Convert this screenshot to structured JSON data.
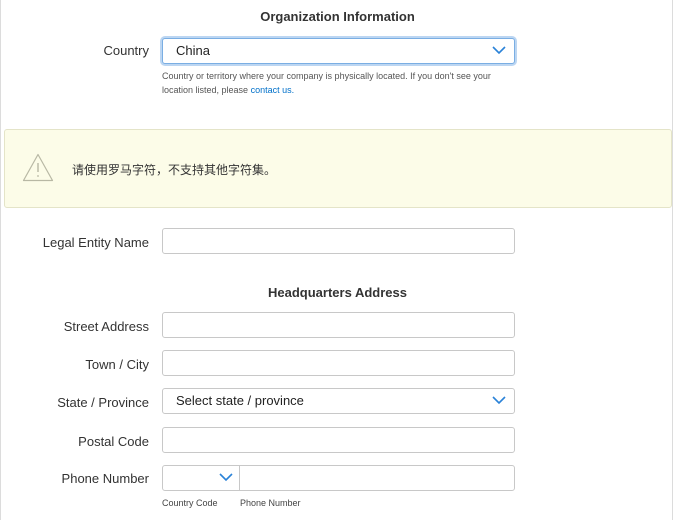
{
  "org_section": {
    "title": "Organization Information"
  },
  "country": {
    "label": "Country",
    "value": "China",
    "helper_text": "Country or territory where your company is physically located. If you don't see your location listed, please ",
    "helper_link": "contact us."
  },
  "warning": {
    "icon": "warning-triangle-icon",
    "message": "请使用罗马字符，不支持其他字符集。"
  },
  "legal_entity": {
    "label": "Legal Entity Name",
    "value": ""
  },
  "hq_section": {
    "title": "Headquarters Address"
  },
  "street": {
    "label": "Street Address",
    "value": ""
  },
  "city": {
    "label": "Town / City",
    "value": ""
  },
  "state": {
    "label": "State / Province",
    "value": "Select state / province"
  },
  "postal": {
    "label": "Postal Code",
    "value": ""
  },
  "phone": {
    "label": "Phone Number",
    "country_code_value": "",
    "number_value": "",
    "country_code_caption": "Country Code",
    "number_caption": "Phone Number"
  },
  "colors": {
    "link": "#0070c9",
    "chevron": "#2a82d8",
    "warning_bg": "#fcfce8",
    "focus_ring": "#bcd6f2"
  }
}
